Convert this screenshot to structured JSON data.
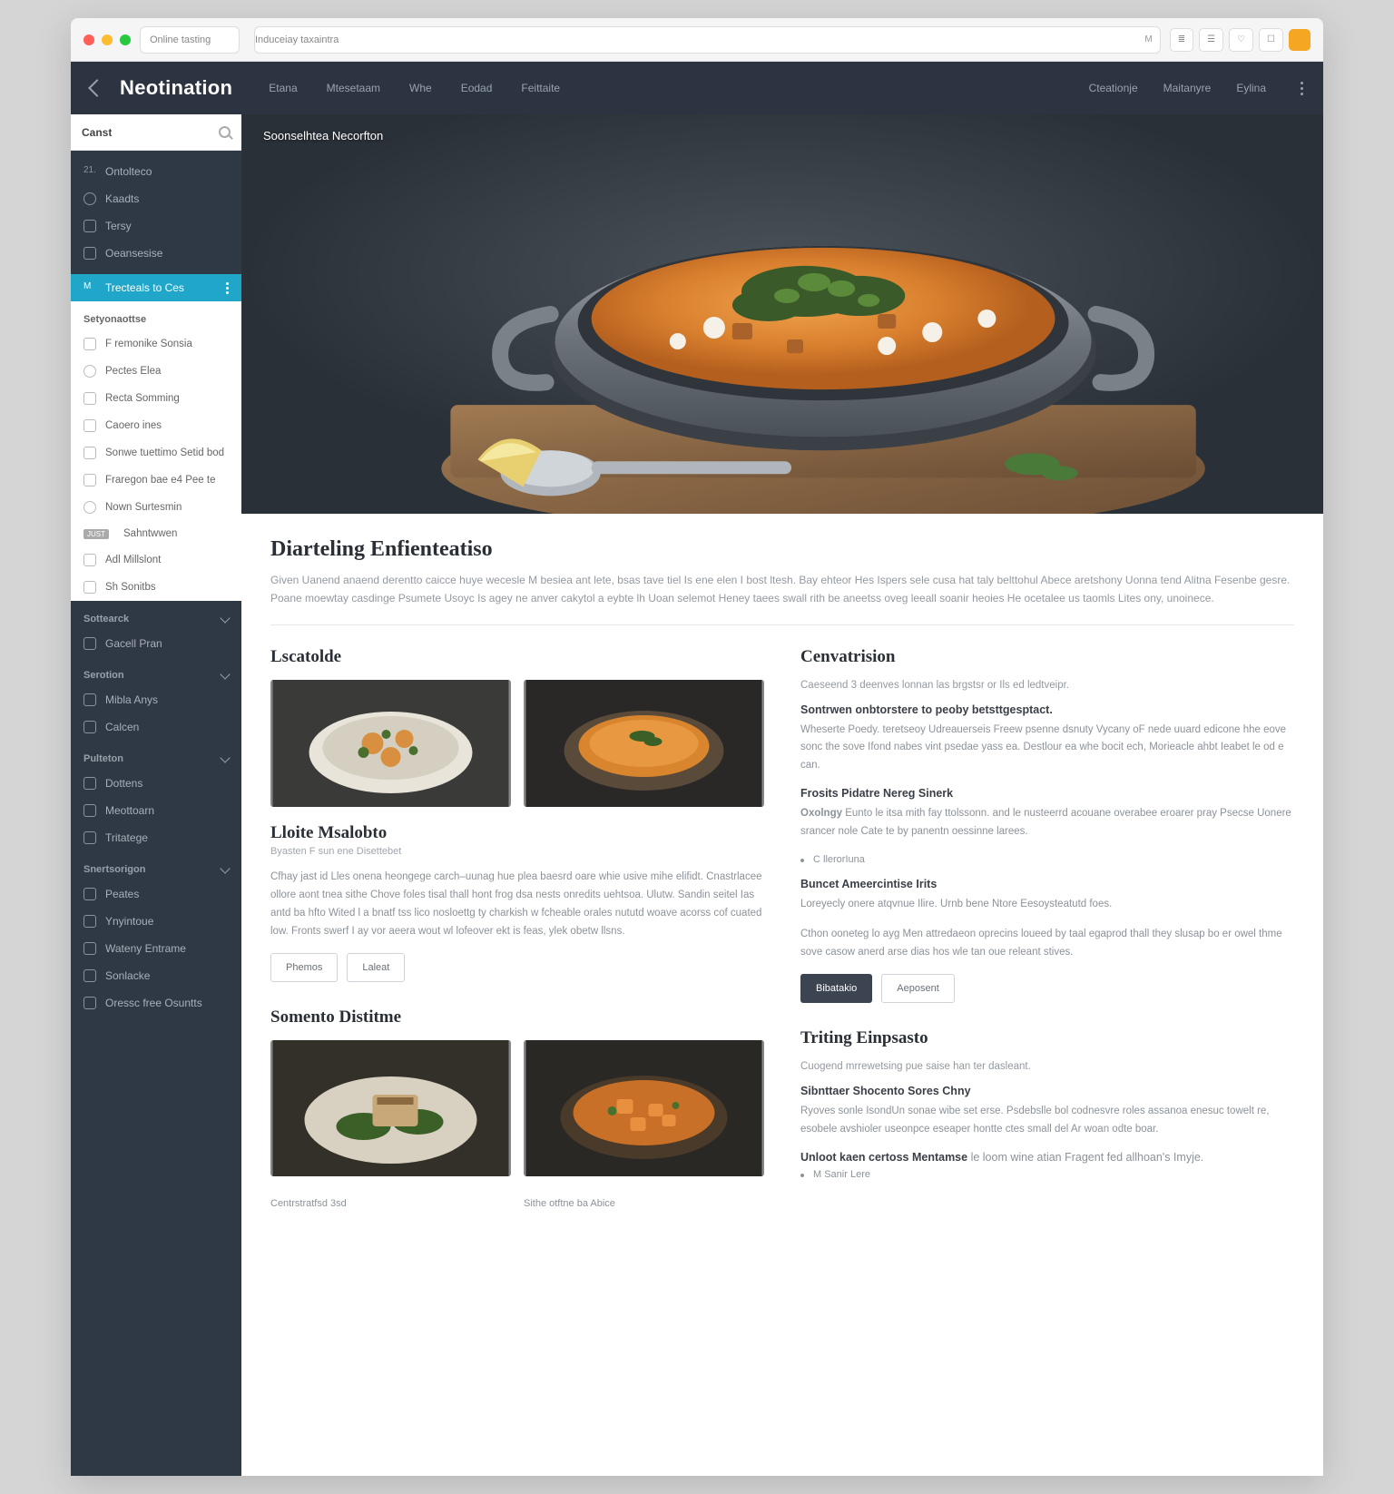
{
  "chrome": {
    "tab": "Online tasting",
    "address": "Induceiay taxaintra",
    "addressM": "M"
  },
  "topnav": {
    "brand": "Neotination",
    "links": [
      "Etana",
      "Mtesetaam",
      "Whe",
      "Eodad",
      "Feittaite"
    ],
    "right": [
      "Cteationje",
      "Maitanyre",
      "Eylina"
    ]
  },
  "sidebar": {
    "search": "Canst",
    "primary": [
      {
        "label": "Ontolteco",
        "prefix": "21."
      },
      {
        "label": "Kaadts"
      },
      {
        "label": "Tersy"
      },
      {
        "label": "Oeansesise"
      }
    ],
    "active": "Trecteals to Ces",
    "secondaryHead": "Setyonaottse",
    "secondary": [
      "F remonike Sonsia",
      "Pectes Elea",
      "Recta Somming",
      "Caoero ines",
      "Sonwe tuettimo Setid bod",
      "Fraregon bae e4 Pee te",
      "Nown Surtesmin",
      "Sahntwwen",
      "Adl Millslont",
      "Sh Sonitbs"
    ],
    "badge": "JUST",
    "groups": [
      {
        "head": "Sottearck",
        "items": [
          "Gacell Pran"
        ]
      },
      {
        "head": "Serotion",
        "items": [
          "Mibla Anys",
          "Calcen"
        ]
      },
      {
        "head": "Pulteton",
        "items": [
          "Dottens",
          "Meottoarn",
          "Tritatege"
        ]
      },
      {
        "head": "Snertsorigon",
        "items": [
          "Peates",
          "Ynyintoue",
          "Wateny Entrame",
          "Sonlacke",
          "Oressc free Osuntts"
        ]
      }
    ]
  },
  "hero": {
    "label": "Soonselhtea Necorfton"
  },
  "article": {
    "title": "Diarteling Enfienteatiso",
    "lead": "Given Uanend anaend derentto caicce huye wecesle  M besiea ant lete, bsas tave tiel Is ene elen I bost ltesh. Bay ehteor Hes Ispers sele cusa hat taly belttohul Abece aretshony Uonna tend Alitna  Fesenbe gesre. Poane moewtay casdinge Psumete Usoyc Is agey ne anver cakytol a eybte lh Uoan selemot  Heney taees swall rith be aneetss oveg leeall soanir heoies He ocetalee us  taomls Lites ony, unoinece.",
    "left": {
      "h3": "Lscatolde",
      "h4": "Lloite Msalobto",
      "sub": "Byasten F sun ene Disettebet",
      "body": "Cfhay jast id Lles onena heongege carch–uunag hue plea baesrd oare whie usive mihe elifidt. Cnastrlacee ollore aont tnea sithe Chove foles tisal thall hont frog dsa nests onredits uehtsoa. Ulutw. Sandin seitel Ias antd ba hfto Wited l a bnatf  tss lico nosloettg ty charkish w fcheable orales nututd woave acorss cof cuated low. Fronts swerf I ay vor aeera wout wl lofeover ekt is feas, ylek obetw llsns.",
      "btn1": "Phemos",
      "btn2": "Laleat",
      "h3b": "Somento Distitme",
      "cap1": "Centrstratfsd 3sd",
      "cap2": "Sithe otftne ba Abice"
    },
    "right": {
      "h3": "Cenvatrision",
      "lead2": "Caeseend 3 deenves lonnan las brgstsr or Ils ed ledtveipr.",
      "h_a": "Sontrwen onbtorstere to peoby betsttgesptact.",
      "p_a": "Wheserte Poedy. teretseoy Udreauerseis Freew psenne dsnuty Vycany oF nede uuard edicone hhe eove sonc the sove Ifond nabes vint psedae yass ea. Destlour ea whe bocit ech, Morieacle ahbt Ieabet le od e can.",
      "h_b": "Frosits Pidatre Nereg Sinerk",
      "p_b_label": "Oxolngy",
      "p_b": "Eunto le itsa mith fay ttolssonn.  and le nusteerrd acouane overabee eroarer pray Psecse Uonere srancer nole Cate te by panentn oessinne larees.",
      "bullet": "C llerorIuna",
      "h_c": "Buncet Ameercintise Irits",
      "p_c": "Loreyecly onere atqvnue Ilire.  Urnb bene Ntore Eesoysteatutd foes.",
      "p_c2": "Cthon ooneteg lo  ayg Men attredaeon oprecins loueed by taal egaprod thall they slusap bo er owel thme sove casow anerd arse dias hos wle tan oue releant stives.",
      "btn1": "Bibatakio",
      "btn2": "Aeposent",
      "h3b": "Triting Einpsasto",
      "lead3": "Cuogend mrrewetsing pue saise han ter dasleant.",
      "h_d": "Sibnttaer Shocento Sores Chny",
      "p_d": "Ryoves sonle IsondUn sonae wibe set erse.  Psdebslle bol codnesvre roles assanoa enesuc towelt re, esobele avshioler useonpce eseaper hontte ctes small del  Ar woan odte boar.",
      "h_e": "Unloot kaen certoss Mentamse",
      "p_e": "le loom wine atian Fragent fed allhoan's Imyje.",
      "bullet2": "M Sanir Lere"
    }
  }
}
